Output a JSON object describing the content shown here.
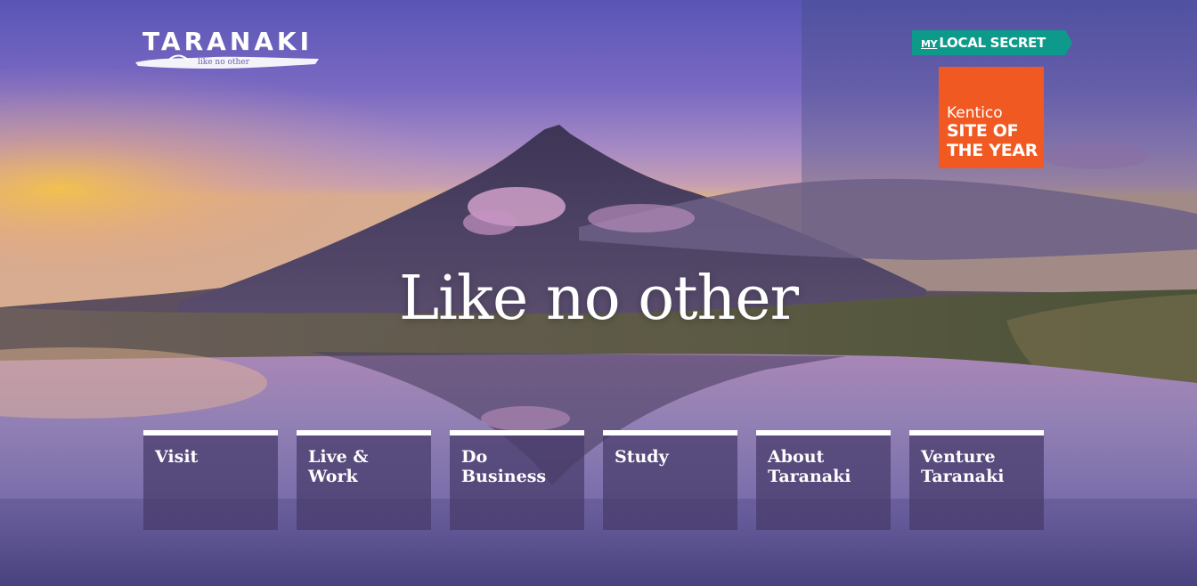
{
  "brand": {
    "name": "TARANAKI",
    "tagline": "like no other"
  },
  "badges": {
    "my_local_secret": {
      "my": "MY",
      "rest": "LOCAL SECRET",
      "color": "#0d9a8a"
    },
    "site_of_the_year": {
      "brand": "Kentico",
      "line1": "SITE OF",
      "line2": "THE YEAR",
      "color": "#f05a22"
    }
  },
  "hero": {
    "headline": "Like no other"
  },
  "nav_tiles": [
    {
      "line1": "Visit",
      "line2": ""
    },
    {
      "line1": "Live &",
      "line2": "Work"
    },
    {
      "line1": "Do",
      "line2": "Business"
    },
    {
      "line1": "Study",
      "line2": ""
    },
    {
      "line1": "About",
      "line2": "Taranaki"
    },
    {
      "line1": "Venture",
      "line2": "Taranaki"
    }
  ]
}
